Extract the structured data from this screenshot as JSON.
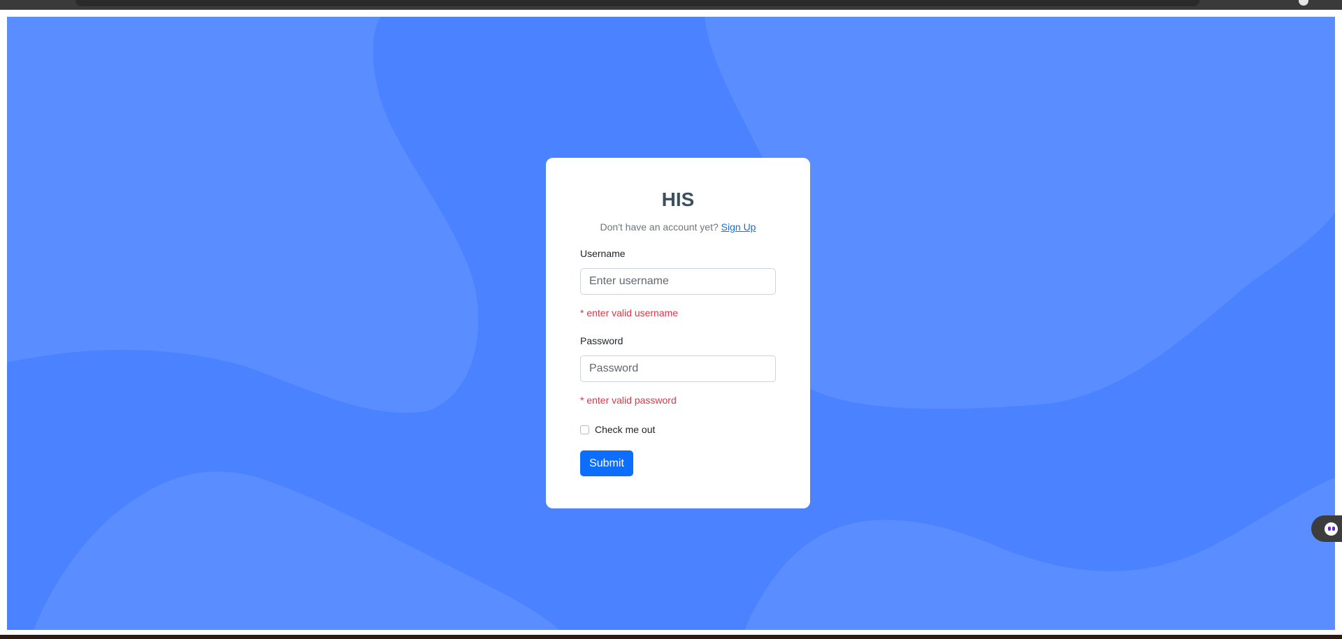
{
  "login": {
    "title": "HIS",
    "signup_prompt": "Don't have an account yet?",
    "signup_link": "Sign Up",
    "username": {
      "label": "Username",
      "placeholder": "Enter username",
      "error": "* enter valid username"
    },
    "password": {
      "label": "Password",
      "placeholder": "Password",
      "error": "* enter valid password"
    },
    "remember_label": "Check me out",
    "remember_checked": false,
    "submit_label": "Submit"
  },
  "colors": {
    "background": "#4a82ff",
    "background_waves": "#5a8dff",
    "primary": "#0d6efd",
    "error": "#dc3545",
    "title": "#3d4f5c"
  },
  "widgets": {
    "assistant_icon": "assistant-face-icon"
  }
}
